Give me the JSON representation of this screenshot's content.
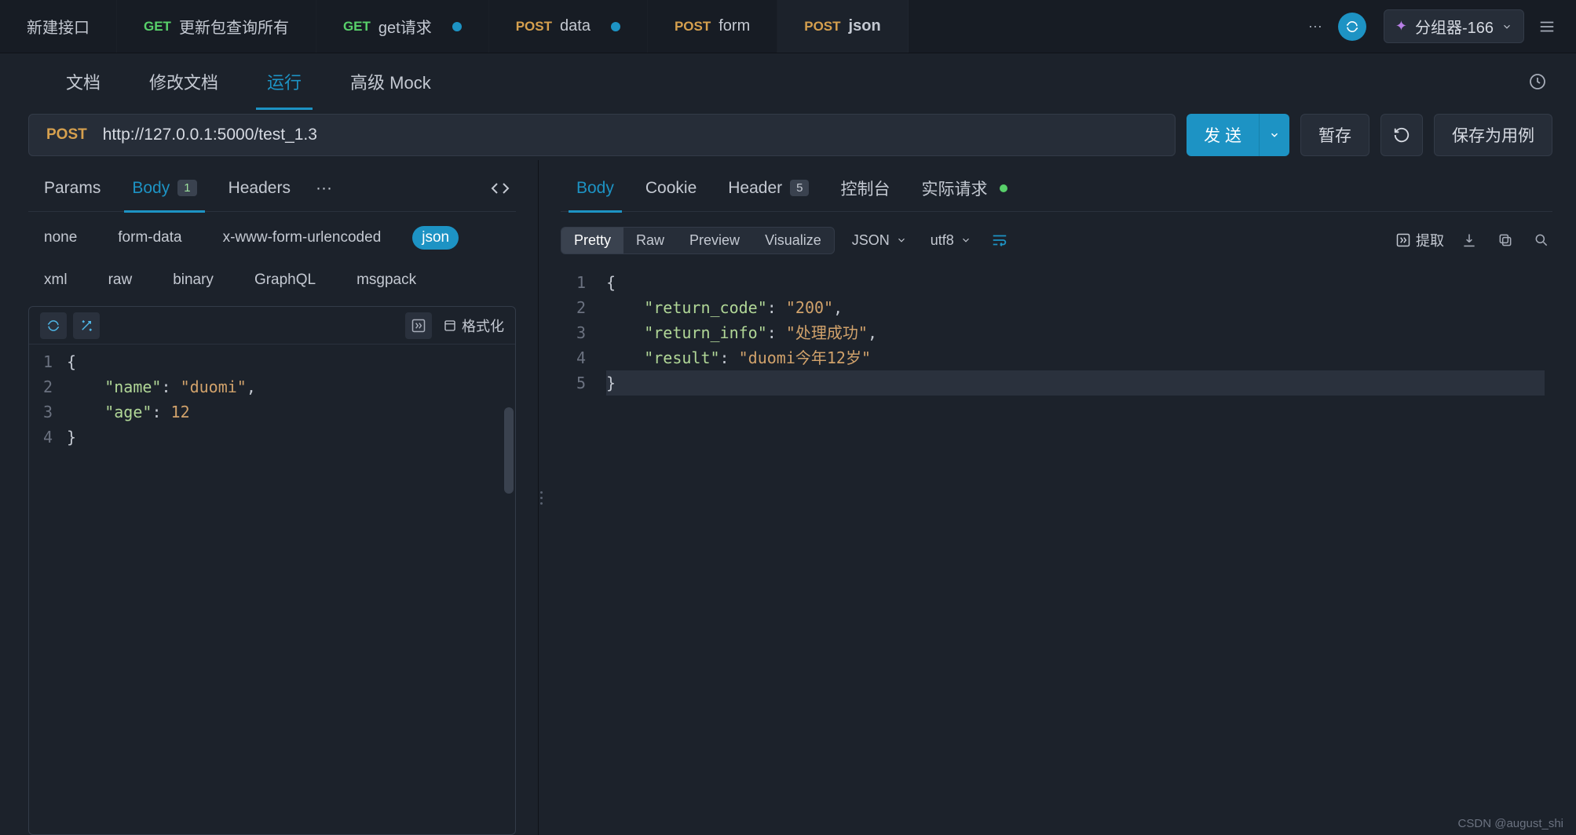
{
  "top_tabs": [
    {
      "method": "",
      "method_cls": "",
      "title": "新建接口",
      "dot": false,
      "active": false
    },
    {
      "method": "GET",
      "method_cls": "get",
      "title": "更新包查询所有",
      "dot": false,
      "active": false
    },
    {
      "method": "GET",
      "method_cls": "get",
      "title": "get请求",
      "dot": true,
      "active": false
    },
    {
      "method": "POST",
      "method_cls": "post",
      "title": "data",
      "dot": true,
      "active": false
    },
    {
      "method": "POST",
      "method_cls": "post",
      "title": "form",
      "dot": false,
      "active": false
    },
    {
      "method": "POST",
      "method_cls": "post",
      "title": "json",
      "dot": false,
      "active": true
    }
  ],
  "group_selector": "分组器-166",
  "subnav": [
    "文档",
    "修改文档",
    "运行",
    "高级 Mock"
  ],
  "subnav_active": "运行",
  "request": {
    "method": "POST",
    "url": "http://127.0.0.1:5000/test_1.3"
  },
  "actions": {
    "send": "发 送",
    "save_draft": "暂存",
    "save_case": "保存为用例"
  },
  "req_tabs": {
    "params": "Params",
    "body": "Body",
    "body_badge": "1",
    "headers": "Headers"
  },
  "body_types": [
    "none",
    "form-data",
    "x-www-form-urlencoded",
    "json",
    "xml",
    "raw",
    "binary",
    "GraphQL",
    "msgpack"
  ],
  "body_type_active": "json",
  "format_label": "格式化",
  "request_body_lines": [
    {
      "n": "1",
      "text": "{",
      "tokens": [
        {
          "t": "{",
          "c": "brace"
        }
      ]
    },
    {
      "n": "2",
      "text": "    \"name\": \"duomi\",",
      "tokens": [
        {
          "t": "    ",
          "c": ""
        },
        {
          "t": "\"name\"",
          "c": "key"
        },
        {
          "t": ": ",
          "c": "punct"
        },
        {
          "t": "\"duomi\"",
          "c": "str"
        },
        {
          "t": ",",
          "c": "punct"
        }
      ]
    },
    {
      "n": "3",
      "text": "    \"age\": 12",
      "tokens": [
        {
          "t": "    ",
          "c": ""
        },
        {
          "t": "\"age\"",
          "c": "key"
        },
        {
          "t": ": ",
          "c": "punct"
        },
        {
          "t": "12",
          "c": "num"
        }
      ]
    },
    {
      "n": "4",
      "text": "}",
      "tokens": [
        {
          "t": "}",
          "c": "brace"
        }
      ]
    }
  ],
  "resp_tabs": {
    "body": "Body",
    "cookie": "Cookie",
    "header": "Header",
    "header_badge": "5",
    "console": "控制台",
    "actual": "实际请求"
  },
  "view_modes": [
    "Pretty",
    "Raw",
    "Preview",
    "Visualize"
  ],
  "view_mode_active": "Pretty",
  "resp_format": "JSON",
  "resp_charset": "utf8",
  "extract_label": "提取",
  "response_lines": [
    {
      "n": "1",
      "hl": false,
      "tokens": [
        {
          "t": "{",
          "c": "brace"
        }
      ]
    },
    {
      "n": "2",
      "hl": false,
      "tokens": [
        {
          "t": "    ",
          "c": ""
        },
        {
          "t": "\"return_code\"",
          "c": "key"
        },
        {
          "t": ": ",
          "c": "punct"
        },
        {
          "t": "\"200\"",
          "c": "str"
        },
        {
          "t": ",",
          "c": "punct"
        }
      ]
    },
    {
      "n": "3",
      "hl": false,
      "tokens": [
        {
          "t": "    ",
          "c": ""
        },
        {
          "t": "\"return_info\"",
          "c": "key"
        },
        {
          "t": ": ",
          "c": "punct"
        },
        {
          "t": "\"处理成功\"",
          "c": "strcn"
        },
        {
          "t": ",",
          "c": "punct"
        }
      ]
    },
    {
      "n": "4",
      "hl": false,
      "tokens": [
        {
          "t": "    ",
          "c": ""
        },
        {
          "t": "\"result\"",
          "c": "key"
        },
        {
          "t": ": ",
          "c": "punct"
        },
        {
          "t": "\"duomi今年12岁\"",
          "c": "strcn"
        }
      ]
    },
    {
      "n": "5",
      "hl": true,
      "tokens": [
        {
          "t": "}",
          "c": "brace"
        }
      ]
    }
  ],
  "watermark": "CSDN @august_shi"
}
